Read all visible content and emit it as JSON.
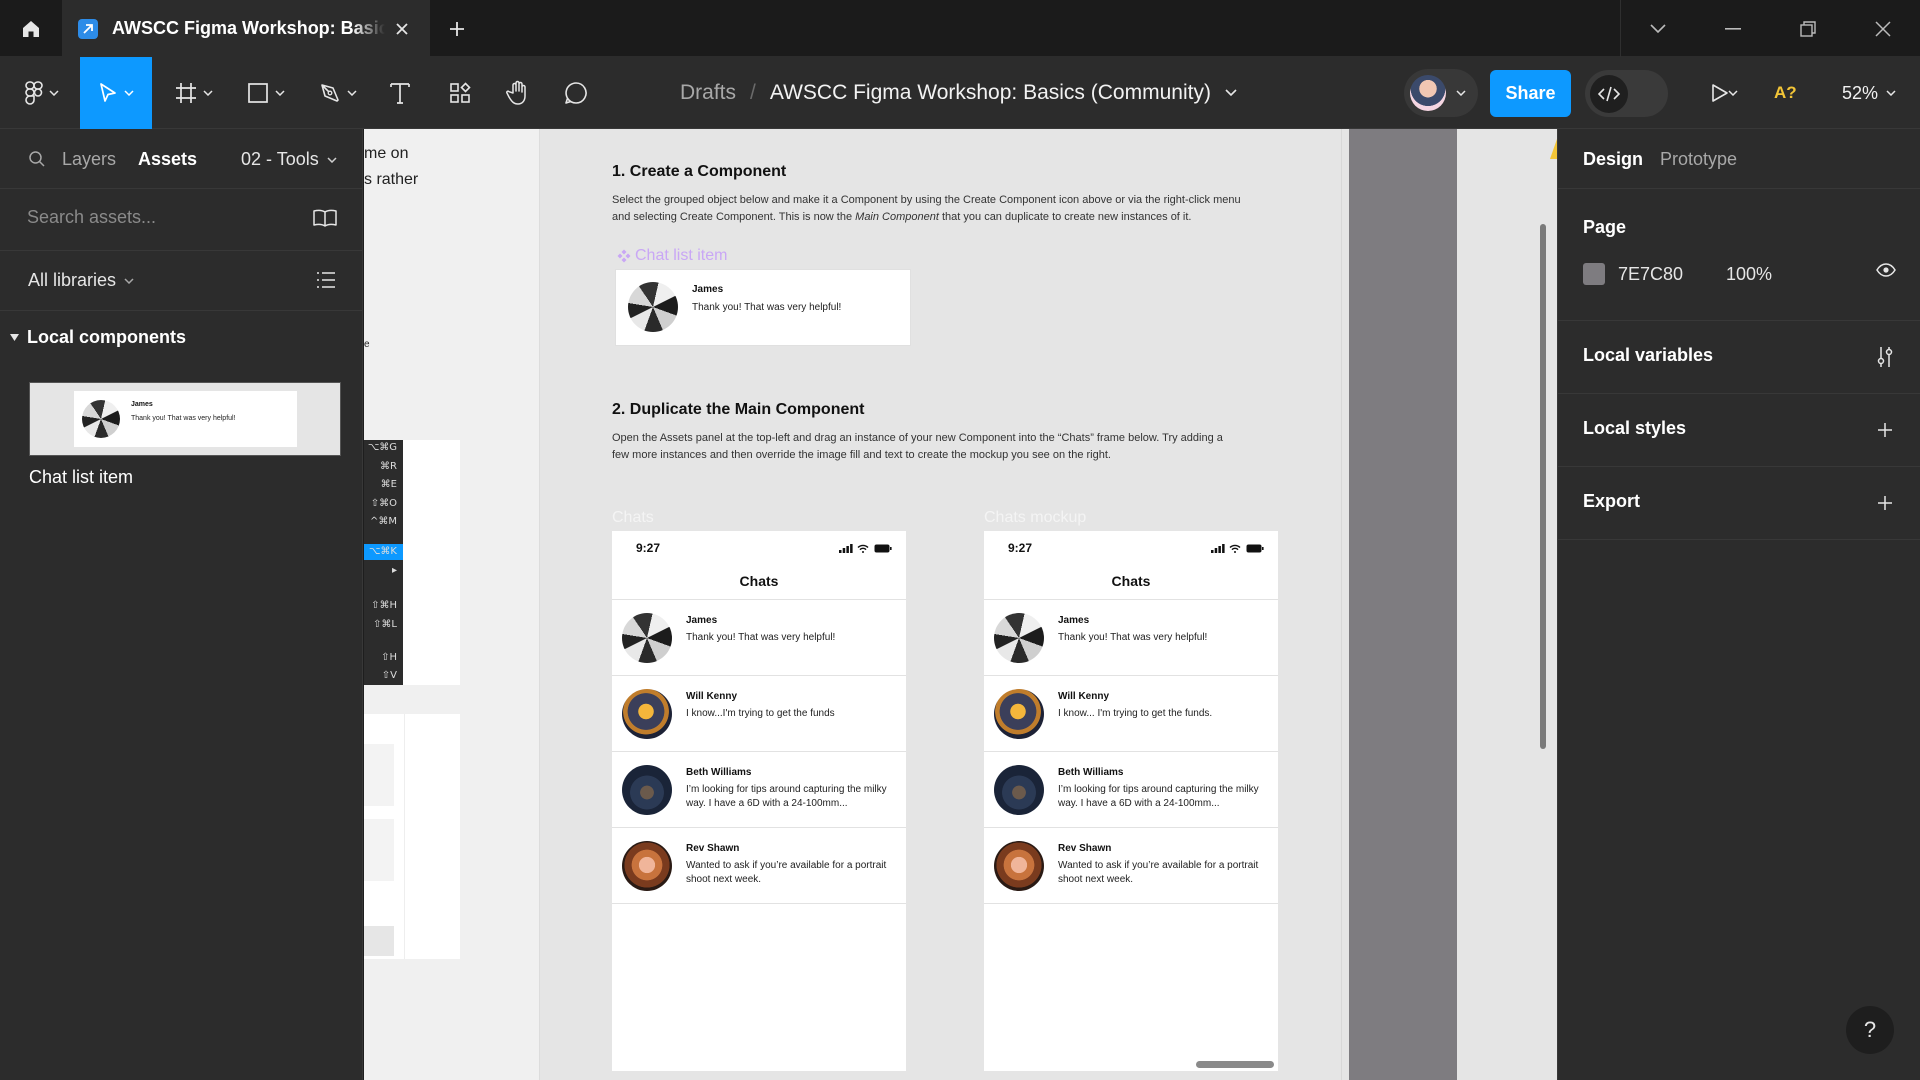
{
  "tab": {
    "title": "AWSCC Figma Workshop: Basics (Community)"
  },
  "toolbar": {
    "breadcrumb_drafts": "Drafts",
    "breadcrumb_sep": "/",
    "file_name": "AWSCC Figma Workshop: Basics (Community)",
    "share_label": "Share",
    "zoom": "52%",
    "a_badge": "A?"
  },
  "left": {
    "tab_layers": "Layers",
    "tab_assets": "Assets",
    "page_select": "02 - Tools",
    "search_placeholder": "Search assets...",
    "libraries_label": "All libraries",
    "local_components": "Local components",
    "component_name": "Chat list item",
    "thumb_name": "James",
    "thumb_msg": "Thank you! That was very helpful!"
  },
  "canvas": {
    "frag1": "me on",
    "frag2": "s rather",
    "frag3": "e",
    "menu_shortcuts": [
      "⌥⌘G",
      "⌘R",
      "⌘E",
      "⇧⌘O",
      "^⌘M",
      "⌥⌘K",
      "▸",
      "⇧⌘H",
      "⇧⌘L",
      "⇧H",
      "⇧V"
    ],
    "section1_title": "1. Create a Component",
    "section1_body_a": "Select the grouped object below and make it a Component by using the Create Component icon above or via the right-click menu",
    "section1_body_b": "and selecting Create Component. This is now the ",
    "section1_body_em": "Main Component",
    "section1_body_c": " that you can duplicate to create new instances of it.",
    "component_label": "Chat list item",
    "section2_title": "2. Duplicate the Main Component",
    "section2_body_a": "Open the Assets panel at the top-left and drag an instance of your new Component into the “Chats” frame below. Try adding a",
    "section2_body_b": "few more instances and then override the image fill and text to create the mockup you see on the right.",
    "frame_chats": "Chats",
    "frame_mockup": "Chats mockup",
    "phone_time": "9:27",
    "phone_title": "Chats",
    "chats_left": [
      {
        "name": "James",
        "msg": "Thank you! That was very helpful!"
      },
      {
        "name": "Will Kenny",
        "msg": "I know...I'm trying to get the funds"
      },
      {
        "name": "Beth Williams",
        "msg": "I’m looking for tips around capturing the milky way. I have a 6D with a 24-100mm..."
      },
      {
        "name": "Rev Shawn",
        "msg": "Wanted to ask if you’re available for a portrait shoot next week."
      }
    ],
    "chats_right": [
      {
        "name": "James",
        "msg": "Thank you! That was very helpful!"
      },
      {
        "name": "Will Kenny",
        "msg": "I know... I'm trying to get the funds."
      },
      {
        "name": "Beth Williams",
        "msg": "I’m looking for tips around capturing the milky way. I have a 6D with a 24-100mm..."
      },
      {
        "name": "Rev Shawn",
        "msg": "Wanted to ask if you’re available for a portrait shoot next week."
      }
    ]
  },
  "right": {
    "tab_design": "Design",
    "tab_prototype": "Prototype",
    "page_label": "Page",
    "page_color": "7E7C80",
    "page_opacity": "100%",
    "local_variables": "Local variables",
    "local_styles": "Local styles",
    "export": "Export",
    "help": "?"
  },
  "colors": {
    "accent": "#0d99ff",
    "page_bg": "#7e7c80",
    "component_purple": "#c9a7f5"
  }
}
